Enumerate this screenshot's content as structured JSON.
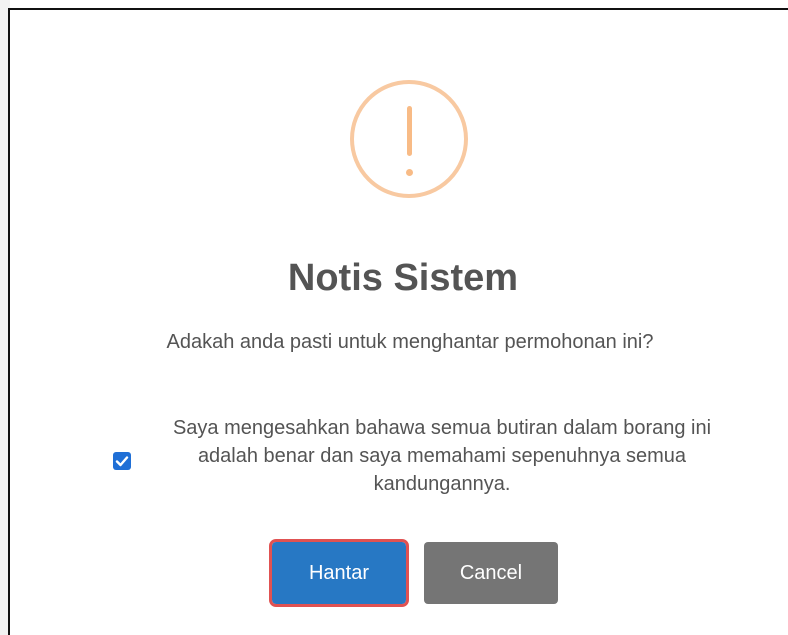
{
  "dialog": {
    "title": "Notis Sistem",
    "message": "Adakah anda pasti untuk menghantar permohonan ini?",
    "confirmation": {
      "checked": true,
      "text": "Saya mengesahkan bahawa semua butiran dalam borang ini adalah benar dan saya memahami sepenuhnya semua kandungannya."
    },
    "buttons": {
      "confirm_label": "Hantar",
      "cancel_label": "Cancel"
    },
    "icon": "warning-exclamation-icon",
    "colors": {
      "icon": "#f8bb86",
      "confirm_button": "#2778c4",
      "cancel_button": "#757575",
      "highlight": "#e05252",
      "text": "#545454"
    }
  }
}
